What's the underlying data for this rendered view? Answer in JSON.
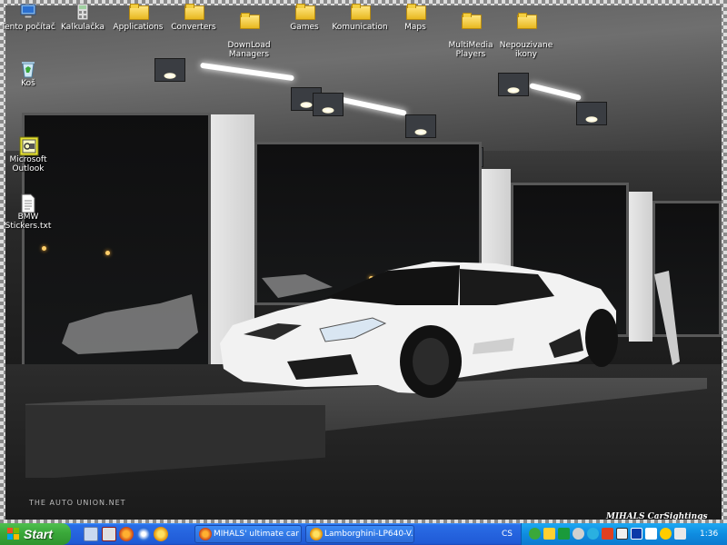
{
  "desktop": {
    "top_icons": [
      {
        "label": "Tento počítač",
        "icon": "my-computer-icon"
      },
      {
        "label": "Kalkulačka",
        "icon": "calculator-icon"
      },
      {
        "label": "Applications",
        "icon": "folder-icon"
      },
      {
        "label": "Converters",
        "icon": "folder-icon"
      },
      {
        "label": "DownLoad\nManagers",
        "icon": "folder-icon"
      },
      {
        "label": "Games",
        "icon": "folder-icon"
      },
      {
        "label": "Komunication",
        "icon": "folder-icon"
      },
      {
        "label": "Maps",
        "icon": "folder-icon"
      },
      {
        "label": "MultiMedia\nPlayers",
        "icon": "folder-icon"
      },
      {
        "label": "Nepouzivane\nikony",
        "icon": "folder-icon"
      }
    ],
    "left_icons": [
      {
        "label": "Koš",
        "icon": "recycle-bin-icon"
      },
      {
        "label": "Microsoft\nOutlook",
        "icon": "outlook-icon"
      },
      {
        "label": "BMW\nStickers.txt",
        "icon": "text-file-icon"
      }
    ]
  },
  "wallpaper": {
    "watermark_left": "THE AUTO UNION.NET",
    "watermark_right": "MIHALS CarSightings"
  },
  "taskbar": {
    "start_label": "Start",
    "quick_launch": [
      "show-desktop-icon",
      "internet-explorer-icon",
      "firefox-icon",
      "media-player-icon",
      "messenger-icon"
    ],
    "tasks": [
      {
        "label": "MIHALS' ultimate car ...",
        "icon": "firefox-icon"
      },
      {
        "label": "Lamborghini-LP640-V...",
        "icon": "image-viewer-icon"
      }
    ],
    "language": "CS",
    "tray_icons": [
      "settings-icon",
      "network-icon",
      "speaker-icon",
      "antivirus-icon",
      "messenger-tray-icon",
      "update-icon",
      "winamp-icon",
      "display-icon"
    ],
    "clock": "1:36"
  },
  "colors": {
    "taskbar_blue": "#2563de",
    "start_green": "#3aa83a",
    "tray_blue": "#0f8ce0"
  }
}
